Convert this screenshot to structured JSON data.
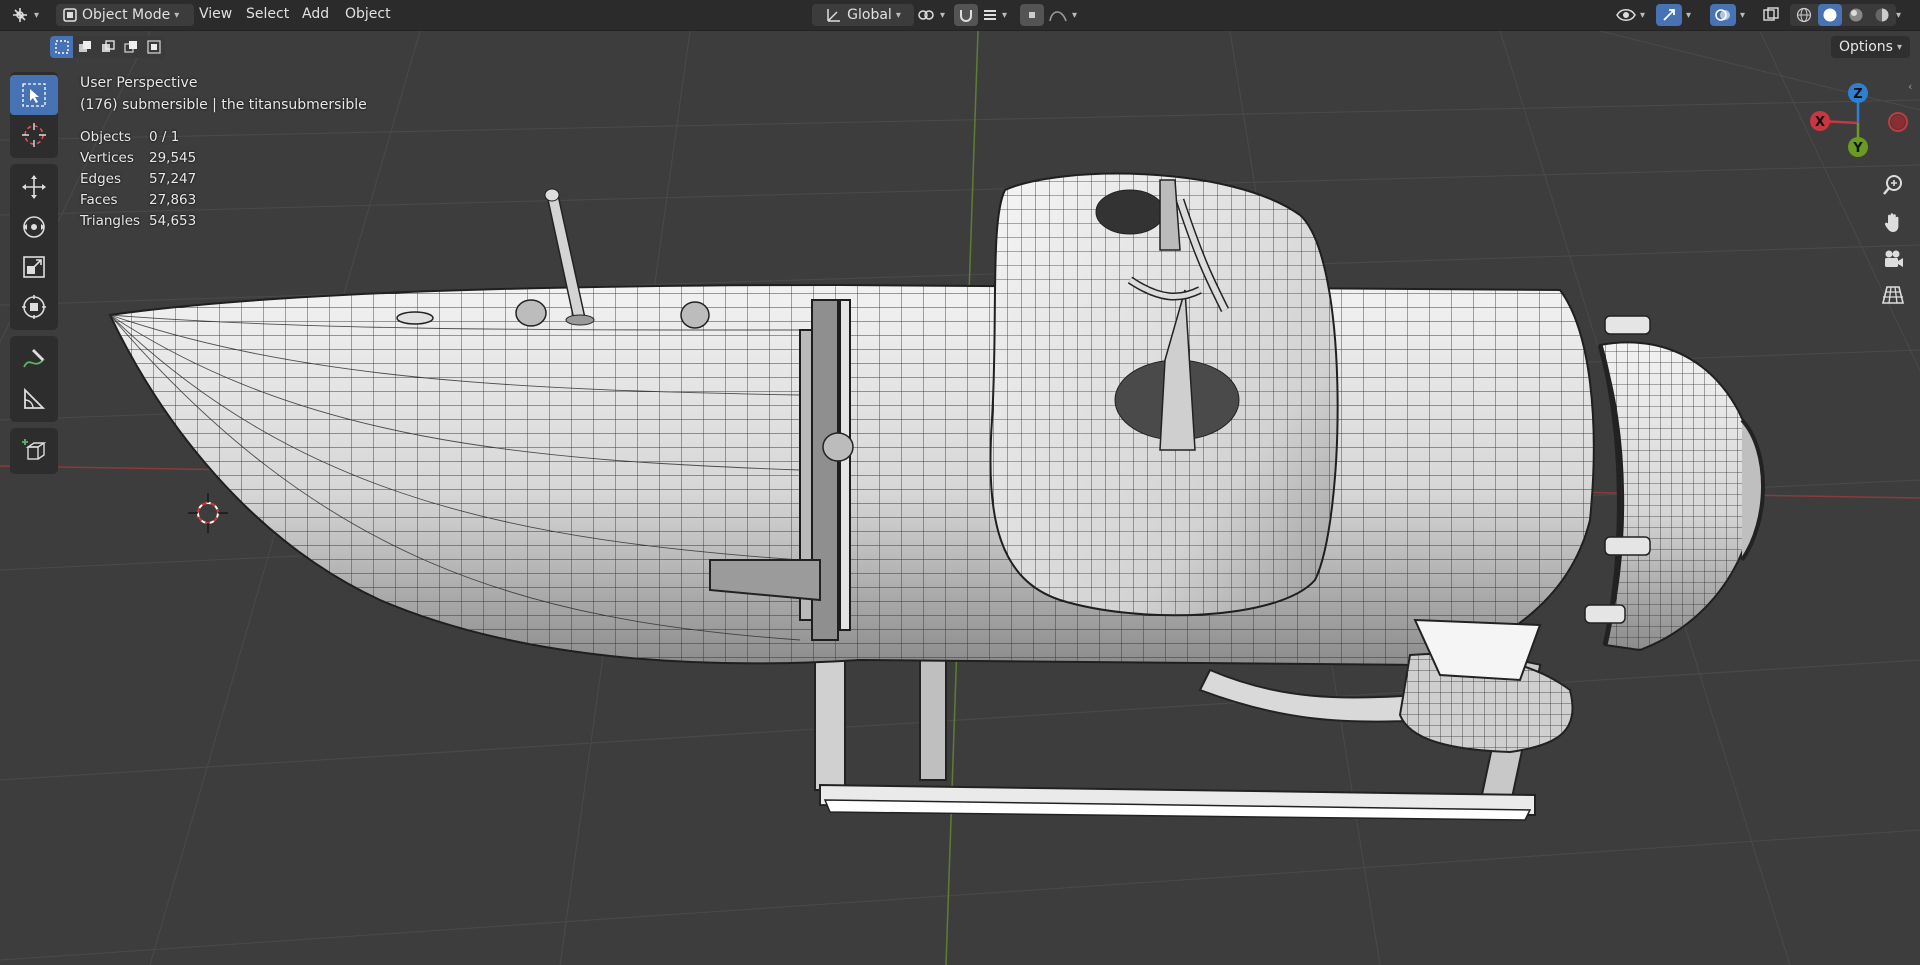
{
  "header": {
    "mode_label": "Object Mode",
    "menus": [
      "View",
      "Select",
      "Add",
      "Object"
    ],
    "transform_orientation": "Global",
    "options_label": "Options"
  },
  "overlay": {
    "view_name": "User Perspective",
    "collection_info": "(176) submersible | the titansubmersible",
    "stats": [
      {
        "label": "Objects",
        "value": "0 / 1"
      },
      {
        "label": "Vertices",
        "value": "29,545"
      },
      {
        "label": "Edges",
        "value": "57,247"
      },
      {
        "label": "Faces",
        "value": "27,863"
      },
      {
        "label": "Triangles",
        "value": "54,653"
      }
    ]
  },
  "gizmo": {
    "x_label": "X",
    "y_label": "Y",
    "z_label": "Z"
  },
  "colors": {
    "accent": "#4772b3",
    "x_axis": "#c8373f",
    "y_axis": "#6a9a22",
    "z_axis": "#2f7fd2"
  },
  "icons": {
    "toolbar": [
      "select-box-icon",
      "cursor-icon",
      "move-icon",
      "rotate-icon",
      "scale-icon",
      "transform-icon",
      "annotate-icon",
      "measure-icon",
      "add-cube-icon"
    ],
    "navigation": [
      "zoom-icon",
      "hand-pan-icon",
      "camera-icon",
      "ortho-grid-icon"
    ]
  }
}
